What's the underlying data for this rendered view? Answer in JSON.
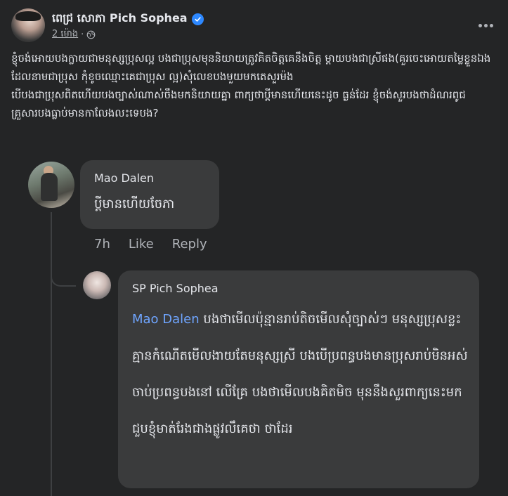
{
  "post": {
    "author": "ពេជ្រ សោភា Pich Sophea",
    "time": "2 ម៉ោង",
    "separator": "·",
    "text": "ខ្ញុំចង់អោយបងក្លាយជាមនុស្សប្រុសល្អ បងជាប្រុសមុននិយាយត្រូវគិតចិត្តគេនឹងចិត្ត ម្តាយបងជាស្រីផង(គួរចេះអោយតម្លៃខ្លួនឯងដែលនាមជាប្រុស កុំខូចឈ្មោះគេជាប្រុស ល្អ)សុំលេខបងមួយមកតេសួរម៉ង\nបើបងជាប្រុសពិតហើយបងច្បាស់ណាស់ចឹងមកនិយាយគ្នា ពាក្យថាប្តីមានហើយនេះដូច ធ្ងន់ដែរ ខ្ញុំចង់សួរបងថាដំណរពូជគ្រួសារបងធ្លាប់មានកាលែងលះទេបង?"
  },
  "comments": [
    {
      "name": "Mao Dalen",
      "text": "ប្តីមានហើយចែភា",
      "time": "7h",
      "like_label": "Like",
      "reply_label": "Reply"
    }
  ],
  "reply": {
    "name": "SP Pich Sophea",
    "mention": "Mao Dalen",
    "text": " បងថាមើលប៉ុន្មានរាប់តិចមើលសុំច្បាស់ៗ មនុស្សប្រុសខ្លះគ្មានកំណើតមើលងាយតែមនុស្សស្រី បងបើប្រពន្ធបងមានប្រុសរាប់មិនអស់ចាប់ប្រពន្ធបងនៅ លើគ្រែ បងថាមើលបងគិតមិច មុននឹងសួរពាក្យនេះមក ជួបខ្ញុំមាត់រែងជាងផ្លូវលឹគេថា ថាដែរ"
  },
  "colors": {
    "background": "#242526",
    "bubble": "#3a3b3c",
    "text_primary": "#e4e6eb",
    "text_secondary": "#b0b3b8",
    "verified": "#2d88ff",
    "mention": "#6fa5ff"
  },
  "icons": {
    "verified": "verified-badge-icon",
    "globe": "globe-icon",
    "more": "more-options-icon"
  }
}
